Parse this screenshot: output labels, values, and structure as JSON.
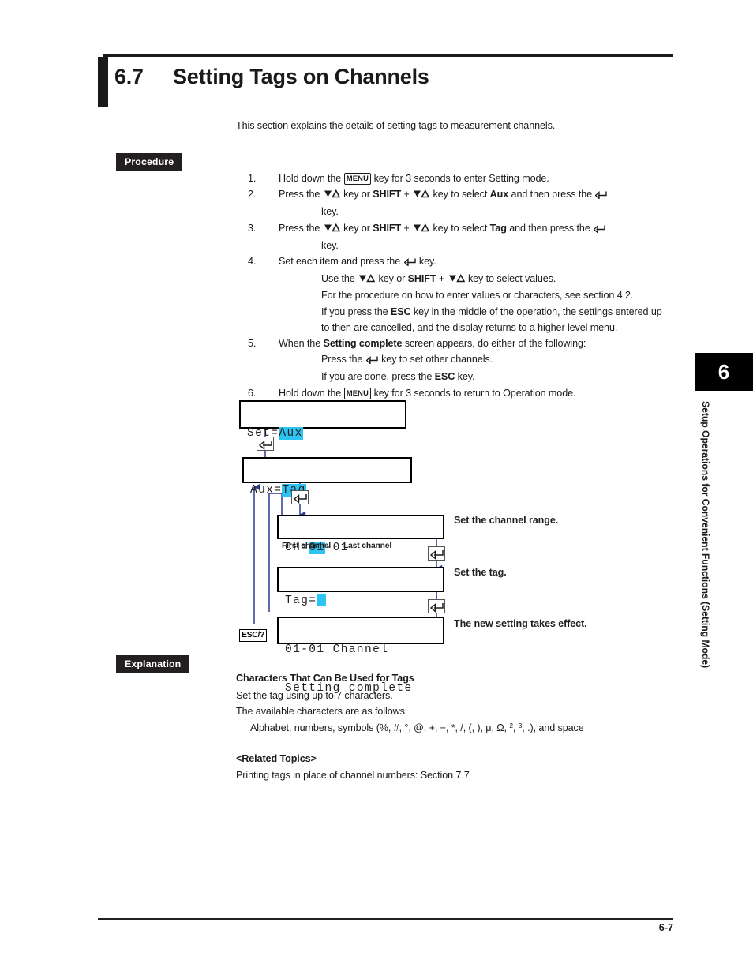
{
  "header": {
    "section_number": "6.7",
    "title": "Setting Tags on Channels",
    "intro": "This section explains the details of setting tags to measurement channels."
  },
  "badges": {
    "procedure": "Procedure",
    "explanation": "Explanation"
  },
  "keys": {
    "menu": "MENU",
    "shift": "SHIFT",
    "esc": "ESC",
    "esc_help": "ESC/?",
    "updown_icon": "down-up-triangle-icon",
    "enter_icon": "enter-return-arrow-icon"
  },
  "procedure": {
    "steps": [
      {
        "num": "1.",
        "lines": [
          "Hold down the [MENU] key for 3 seconds to enter Setting mode."
        ]
      },
      {
        "num": "2.",
        "lines": [
          "Press the ▽△ key or SHIFT + ▽△ key to select Aux and then press the ↵",
          "key."
        ]
      },
      {
        "num": "3.",
        "lines": [
          "Press the ▽△ key or SHIFT + ▽△ key to select Tag and then press the ↵",
          "key."
        ]
      },
      {
        "num": "4.",
        "lines": [
          "Set each item and press the ↵ key.",
          "Use the ▽△ key or SHIFT + ▽△ key to select values.",
          "For the procedure on how to enter values or characters, see section 4.2.",
          "If you press the ESC key in the middle of the operation, the settings entered up",
          "to then are cancelled, and the display returns to a higher level menu."
        ]
      },
      {
        "num": "5.",
        "lines": [
          "When the Setting complete screen appears, do either of the following:",
          "Press the ↵ key to set other channels.",
          "If you are done, press the ESC key."
        ]
      },
      {
        "num": "6.",
        "lines": [
          "Hold down the [MENU] key for 3 seconds to return to Operation mode."
        ]
      }
    ],
    "step1": {
      "num": "1.",
      "pre": "Hold down the ",
      "post": " key for 3 seconds to enter Setting mode."
    },
    "step2": {
      "num": "2.",
      "a": "Press the ",
      "b": " key or ",
      "c": " + ",
      "d": " key to select ",
      "sel": "Aux",
      "e": " and then press the ",
      "f": "key."
    },
    "step3": {
      "num": "3.",
      "a": "Press the ",
      "b": " key or ",
      "c": " + ",
      "d": " key to select ",
      "sel": "Tag",
      "e": " and then press the ",
      "f": "key."
    },
    "step4": {
      "num": "4.",
      "a": "Set each item and press the ",
      "b": " key.",
      "c": "Use the ",
      "d": " key or ",
      "e": " + ",
      "f": " key to select values.",
      "g": "For the procedure on how to enter values or characters, see section 4.2.",
      "h1": "If you press the ",
      "h2": " key in the middle of the operation, the settings entered up",
      "h3": "to then are cancelled, and the display returns to a higher level menu."
    },
    "step5": {
      "num": "5.",
      "a": "When the ",
      "sel": "Setting complete",
      "b": " screen appears, do either of the following:",
      "c": "Press the ",
      "d": " key to set other channels.",
      "e": "If you are done, press the ",
      "f": " key."
    },
    "step6": {
      "num": "6.",
      "pre": "Hold down the ",
      "post": " key for 3 seconds to return to Operation mode."
    }
  },
  "diagram": {
    "screens": [
      {
        "id": "set-aux",
        "prefix": "Set=",
        "value": "Aux"
      },
      {
        "id": "aux-tag",
        "prefix": "Aux=",
        "value": "Tag"
      },
      {
        "id": "ch-range",
        "prefix": "CH=",
        "value": "01",
        "suffix": "-01"
      },
      {
        "id": "tag-entry",
        "prefix": "Tag=",
        "value": ""
      },
      {
        "id": "complete",
        "line1": "01-01 Channel",
        "line2": "Setting complete"
      }
    ],
    "labels": {
      "first_channel": "First channel",
      "last_channel": "Last channel",
      "set_channel_range": "Set the channel range.",
      "set_the_tag": "Set the tag.",
      "new_setting": "The new setting takes effect."
    },
    "esc_button": "ESC/?",
    "highlight_color": "#2BC4F3"
  },
  "explanation": {
    "heading": "Characters That Can Be Used for Tags",
    "line1": "Set the tag using up to 7 characters.",
    "line2": "The available characters are as follows:",
    "chars_pre": "Alphabet, numbers, symbols (%, #, °, @, +, −, *, /, (, ), μ, Ω, ",
    "chars_sup2": "2",
    "chars_mid": ", ",
    "chars_sup3": "3",
    "chars_post": ", .), and space",
    "related_heading": "<Related Topics>",
    "related_line": "Printing tags in place of channel numbers: Section 7.7"
  },
  "sidebar": {
    "chapter_number": "6",
    "chapter_title": "Setup Operations for Convenient Functions (Setting Mode)"
  },
  "footer": {
    "page_number": "6-7"
  }
}
